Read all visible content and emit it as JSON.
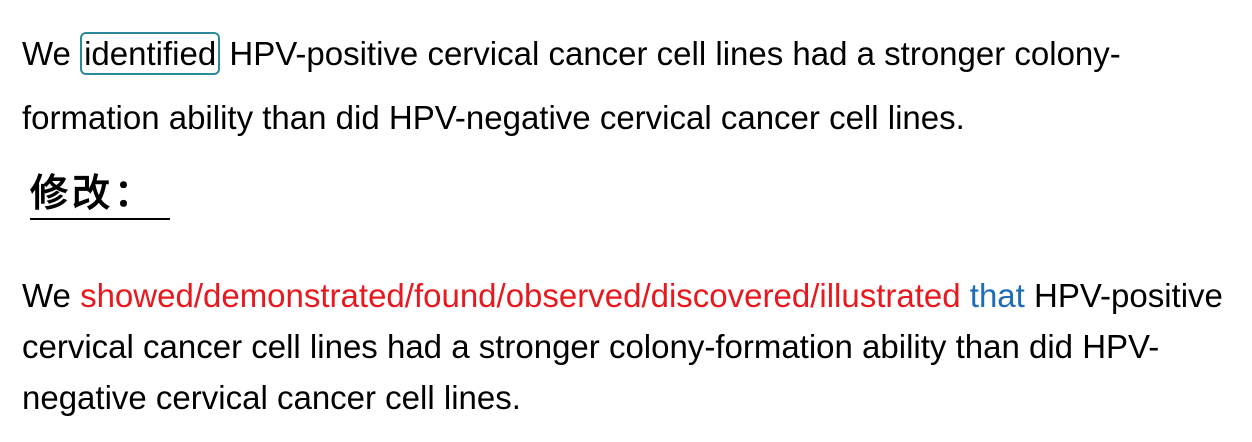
{
  "original": {
    "prefix": "We",
    "highlighted_word": "identified",
    "rest": "HPV-positive cervical cancer cell lines had a stronger colony-formation ability than did HPV-negative cervical cancer cell lines.",
    "highlight_color": "#2a8a9a"
  },
  "heading": "修改：",
  "revision": {
    "prefix": "We",
    "alternatives": "showed/demonstrated/found/observed/discovered/illustrated",
    "inserted_word": "that",
    "rest": "HPV-positive cervical cancer cell lines had a stronger colony-formation ability than did HPV-negative cervical cancer cell lines.",
    "alternatives_color": "#e8191e",
    "inserted_color": "#1f6db6"
  }
}
